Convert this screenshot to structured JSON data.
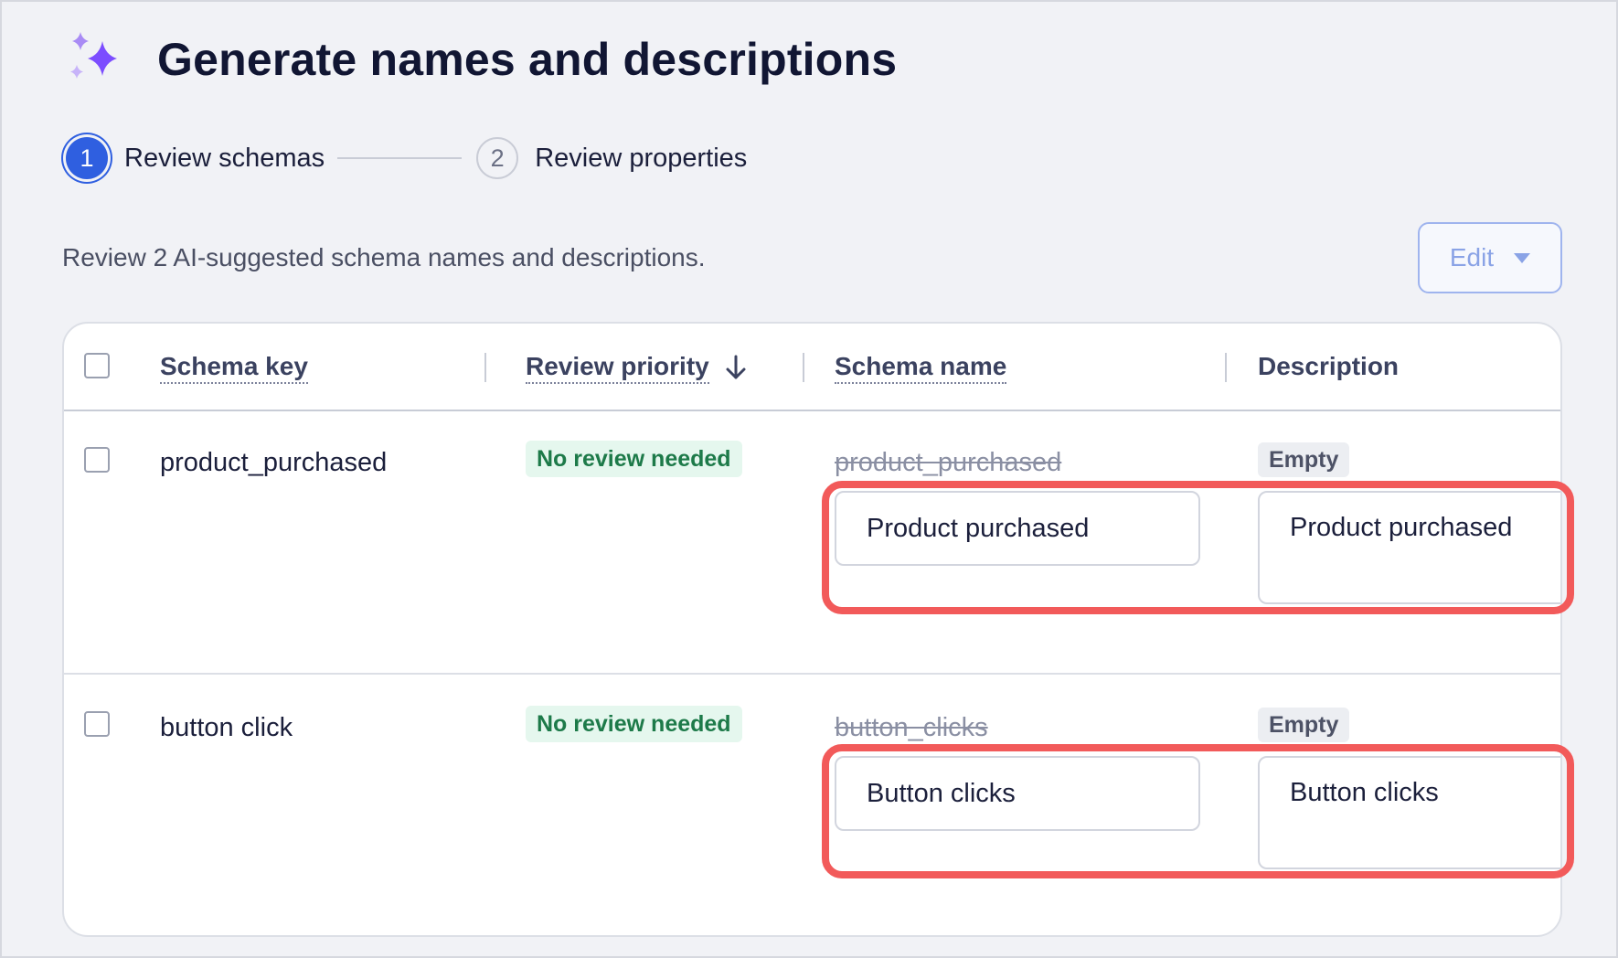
{
  "header": {
    "title": "Generate names and descriptions",
    "icon": "sparkle-icon",
    "accent_color": "#8b5cf6"
  },
  "stepper": {
    "steps": [
      {
        "number": "1",
        "label": "Review schemas",
        "state": "active"
      },
      {
        "number": "2",
        "label": "Review properties",
        "state": "inactive"
      }
    ]
  },
  "intro": "Review 2 AI-suggested schema names and descriptions.",
  "toolbar": {
    "edit_label": "Edit"
  },
  "table": {
    "columns": [
      "Schema key",
      "Review priority",
      "Schema name",
      "Description"
    ],
    "sort": {
      "column": "Review priority",
      "direction": "descending"
    },
    "rows": [
      {
        "key": "product_purchased",
        "priority": "No review needed",
        "original_name": "product_purchased",
        "suggested_name": "Product purchased",
        "original_description": "Empty",
        "suggested_description": "Product purchased"
      },
      {
        "key": "button click",
        "priority": "No review needed",
        "original_name": "button_clicks",
        "suggested_name": "Button clicks",
        "original_description": "Empty",
        "suggested_description": "Button clicks"
      }
    ]
  },
  "colors": {
    "primary": "#2f5fe0",
    "success_badge_bg": "#e5f7ee",
    "success_badge_text": "#1d7a49",
    "highlight": "#f25a5a"
  }
}
